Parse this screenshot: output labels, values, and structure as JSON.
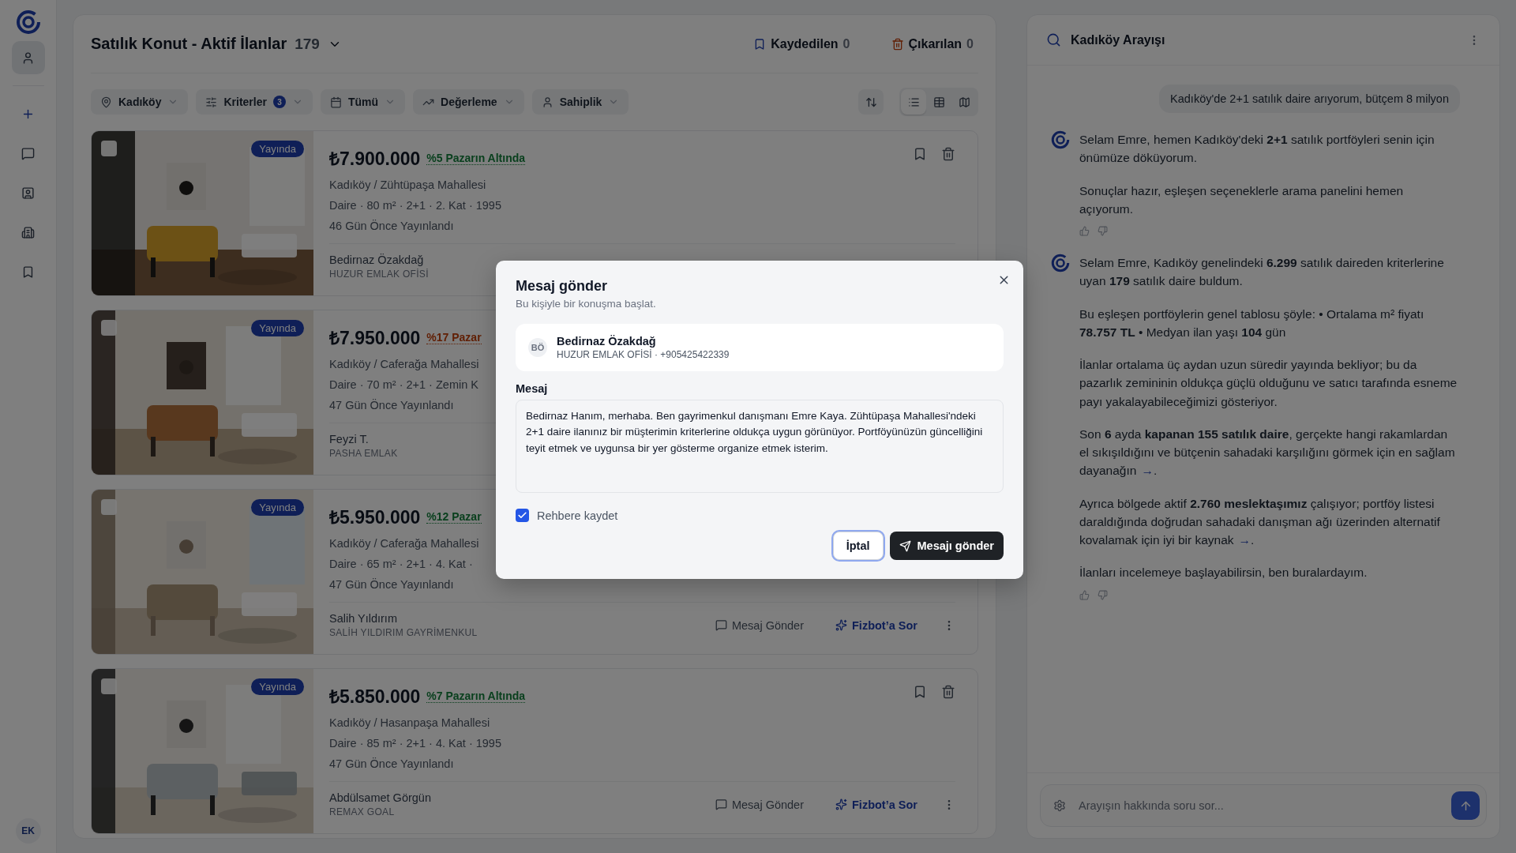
{
  "sidebar": {
    "items": [
      {
        "selected": true
      },
      {
        "selected": false
      },
      {
        "selected": false
      },
      {
        "selected": false
      },
      {
        "selected": false
      },
      {
        "selected": false
      }
    ],
    "avatar": "EK"
  },
  "header": {
    "title": "Satılık Konut - Aktif İlanlar",
    "count": "179",
    "saved": {
      "label": "Kaydedilen",
      "count": "0"
    },
    "removed": {
      "label": "Çıkarılan",
      "count": "0"
    }
  },
  "filters": [
    {
      "label": "Kadıköy"
    },
    {
      "label": "Kriterler",
      "badge": "3"
    },
    {
      "label": "Tümü"
    },
    {
      "label": "Değerleme"
    },
    {
      "label": "Sahiplik"
    }
  ],
  "view_modes": [
    {
      "selected": true
    },
    {
      "selected": false
    },
    {
      "selected": false
    }
  ],
  "listings": [
    {
      "status": "Yayında",
      "price": "₺7.900.000",
      "tag": "%5 Pazarın Altında",
      "kind": "positive",
      "checked": false,
      "location": "Kadıköy / Zühtüpaşa Mahallesi",
      "details": "Daire · 80 m² · 2+1 · 2. Kat · 1995",
      "published": "46 Gün Önce Yayınlandı",
      "agent": "Bedirnaz Özakdağ",
      "office": "HUZUR EMLAK OFİSİ",
      "top_icons": true
    },
    {
      "status": "Yayında",
      "price": "₺7.950.000",
      "tag": "%17 Pazar",
      "kind": "caution",
      "checked": false,
      "location": "Kadıköy / Caferağa Mahallesi",
      "details": "Daire · 70 m² · 2+1 · Zemin K",
      "published": "47 Gün Önce Yayınlandı",
      "agent": "Feyzi T.",
      "office": "PASHA EMLAK"
    },
    {
      "status": "Yayında",
      "price": "₺5.950.000",
      "tag": "%12 Pazar",
      "kind": "positive",
      "checked": false,
      "location": "Kadıköy / Caferağa Mahallesi",
      "details": "Daire · 65 m² · 2+1 · 4. Kat ·",
      "published": "47 Gün Önce Yayınlandı",
      "agent": "Salih Yıldırım",
      "office": "SALİH YILDIRIM GAYRİMENKUL",
      "actions": [
        "Mesaj Gönder",
        "Fizbot’a Sor"
      ]
    },
    {
      "status": "Yayında",
      "price": "₺5.850.000",
      "tag": "%7 Pazarın Altında",
      "kind": "positive",
      "checked": false,
      "location": "Kadıköy / Hasanpaşa Mahallesi",
      "details": "Daire · 85 m² · 2+1 · 4. Kat · 1995",
      "published": "47 Gün Önce Yayınlandı",
      "agent": "Abdülsamet Görgün",
      "office": "REMAX GOAL",
      "top_icons": true,
      "actions": [
        "Mesaj Gönder",
        "Fizbot’a Sor"
      ]
    }
  ],
  "chat": {
    "title": "Kadıköy Arayışı",
    "user_message": "Kadıköy'de 2+1 satılık daire arıyorum, bütçem 8 milyon",
    "replies": [
      {
        "paragraphs": [
          {
            "text": "Selam Emre, hemen Kadıköy'deki **2+1** satılık portföyleri senin için önümüze döküyorum."
          },
          {
            "text": "Sonuçlar hazır, eşleşen seçeneklerle arama panelini hemen açıyorum."
          }
        ]
      },
      {
        "paragraphs": [
          {
            "text": "Selam Emre, Kadıköy genelindeki **6.299** satılık daireden kriterlerine uyan **179** satılık daire buldum."
          },
          {
            "text": "Bu eşleşen portföylerin genel tablosu şöyle: • Ortalama m² fiyatı **78.757 TL** • Medyan ilan yaşı **104** gün"
          },
          {
            "text": "İlanlar ortalama üç aydan uzun süredir yayında bekliyor; bu da pazarlık zemininin oldukça güçlü olduğunu ve satıcı tarafında esneme payı yakalayabileceğimizi gösteriyor."
          },
          {
            "text": "Son **6** ayda **kapanan 155 satılık daire**, gerçekte hangi rakamlardan el sıkışıldığını ve bütçenin sahadaki karşılığını görmek için en sağlam dayanağın",
            "link": "→",
            "tail": "."
          },
          {
            "text": "Ayrıca bölgede aktif **2.760 meslektaşımız** çalışıyor; portföy listesi daraldığında doğrudan sahadaki danışman ağı üzerinden alternatif kovalamak için iyi bir kaynak",
            "link": "→",
            "tail": "."
          },
          {
            "text": "İlanları incelemeye başlayabilirsin, ben buralardayım."
          }
        ]
      }
    ],
    "input_placeholder": "Arayışın hakkında soru sor..."
  },
  "modal": {
    "title": "Mesaj gönder",
    "subtitle": "Bu kişiyle bir konuşma başlat.",
    "contact": {
      "initials": "BÖ",
      "name": "Bedirnaz Özakdağ",
      "meta": "HUZUR EMLAK OFİSİ · +905425422339"
    },
    "field_label": "Mesaj",
    "message": "Bedirnaz Hanım, merhaba. Ben gayrimenkul danışmanı Emre Kaya. Zühtüpaşa Mahallesi'ndeki 2+1 daire ilanınız bir müşterimin kriterlerine oldukça uygun görünüyor. Portföyünüzün güncelliğini teyit etmek ve uygunsa bir yer gösterme organize etmek isterim.",
    "save_contact": {
      "label": "Rehbere kaydet",
      "checked": true
    },
    "cancel": {
      "label": "İptal",
      "focused": true
    },
    "send": {
      "label": "Mesajı gönder"
    }
  }
}
